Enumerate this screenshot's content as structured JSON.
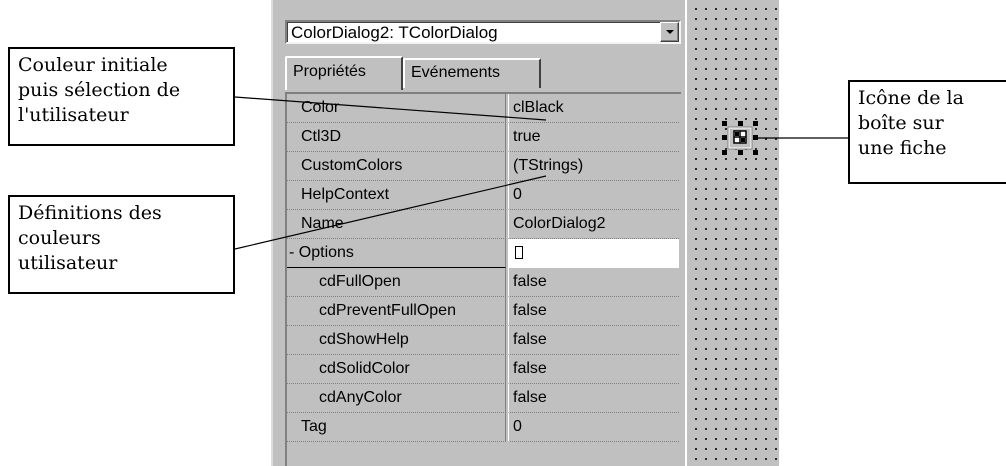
{
  "inspector": {
    "component_select": "ColorDialog2: TColorDialog",
    "tabs": [
      {
        "label": "Propriétés"
      },
      {
        "label": "Evénements"
      }
    ],
    "properties": [
      {
        "name": "Color",
        "value": "clBlack"
      },
      {
        "name": "Ctl3D",
        "value": "true"
      },
      {
        "name": "CustomColors",
        "value": "(TStrings)"
      },
      {
        "name": "HelpContext",
        "value": "0"
      },
      {
        "name": "Name",
        "value": "ColorDialog2"
      },
      {
        "name": "- Options",
        "value": "[]"
      },
      {
        "name": "cdFullOpen",
        "value": "false"
      },
      {
        "name": "cdPreventFullOpen",
        "value": "false"
      },
      {
        "name": "cdShowHelp",
        "value": "false"
      },
      {
        "name": "cdSolidColor",
        "value": "false"
      },
      {
        "name": "cdAnyColor",
        "value": "false"
      },
      {
        "name": "Tag",
        "value": "0"
      }
    ]
  },
  "callouts": {
    "initial_color": [
      "Couleur initiale",
      "puis sélection de",
      "l'utilisateur"
    ],
    "custom_colors": [
      "Définitions des",
      "couleurs",
      "utilisateur"
    ],
    "form_icon": [
      "Icône de la",
      "boîte sur",
      "une fiche"
    ]
  },
  "colors": {
    "panel": "#c0c0c0",
    "selected_value_bg": "#ffffff"
  }
}
